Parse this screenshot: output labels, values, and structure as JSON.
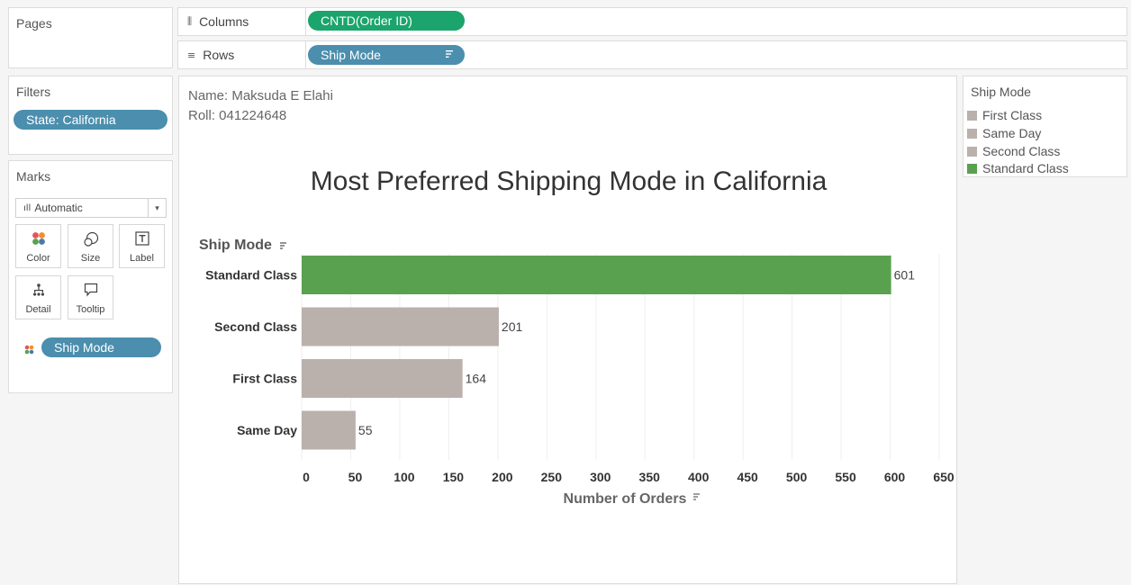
{
  "pages": {
    "title": "Pages"
  },
  "shelves": {
    "columns": {
      "label": "Columns",
      "pill": "CNTD(Order ID)"
    },
    "rows": {
      "label": "Rows",
      "pill": "Ship Mode"
    }
  },
  "filters": {
    "title": "Filters",
    "pill": "State: California"
  },
  "marks": {
    "title": "Marks",
    "type": "Automatic",
    "buttons": [
      "Color",
      "Size",
      "Label",
      "Detail",
      "Tooltip"
    ],
    "color_pill": "Ship Mode"
  },
  "view": {
    "name_line": "Name: Maksuda E Elahi",
    "roll_line": "Roll: 041224648"
  },
  "legend": {
    "title": "Ship Mode",
    "items": [
      {
        "label": "First Class",
        "color": "#bab0ac"
      },
      {
        "label": "Same Day",
        "color": "#bab0ac"
      },
      {
        "label": "Second Class",
        "color": "#bab0ac"
      },
      {
        "label": "Standard Class",
        "color": "#59a14f"
      }
    ]
  },
  "chart_data": {
    "type": "bar",
    "orientation": "horizontal",
    "title": "Most Preferred Shipping Mode in California",
    "ylabel": "Ship Mode",
    "xlabel": "Number of Orders",
    "categories": [
      "Standard Class",
      "Second Class",
      "First Class",
      "Same Day"
    ],
    "values": [
      601,
      201,
      164,
      55
    ],
    "colors": [
      "#59a14f",
      "#bab0ac",
      "#bab0ac",
      "#bab0ac"
    ],
    "xlim": [
      0,
      650
    ],
    "xticks": [
      0,
      50,
      100,
      150,
      200,
      250,
      300,
      350,
      400,
      450,
      500,
      550,
      600,
      650
    ],
    "grid": true,
    "legend_position": "right"
  }
}
